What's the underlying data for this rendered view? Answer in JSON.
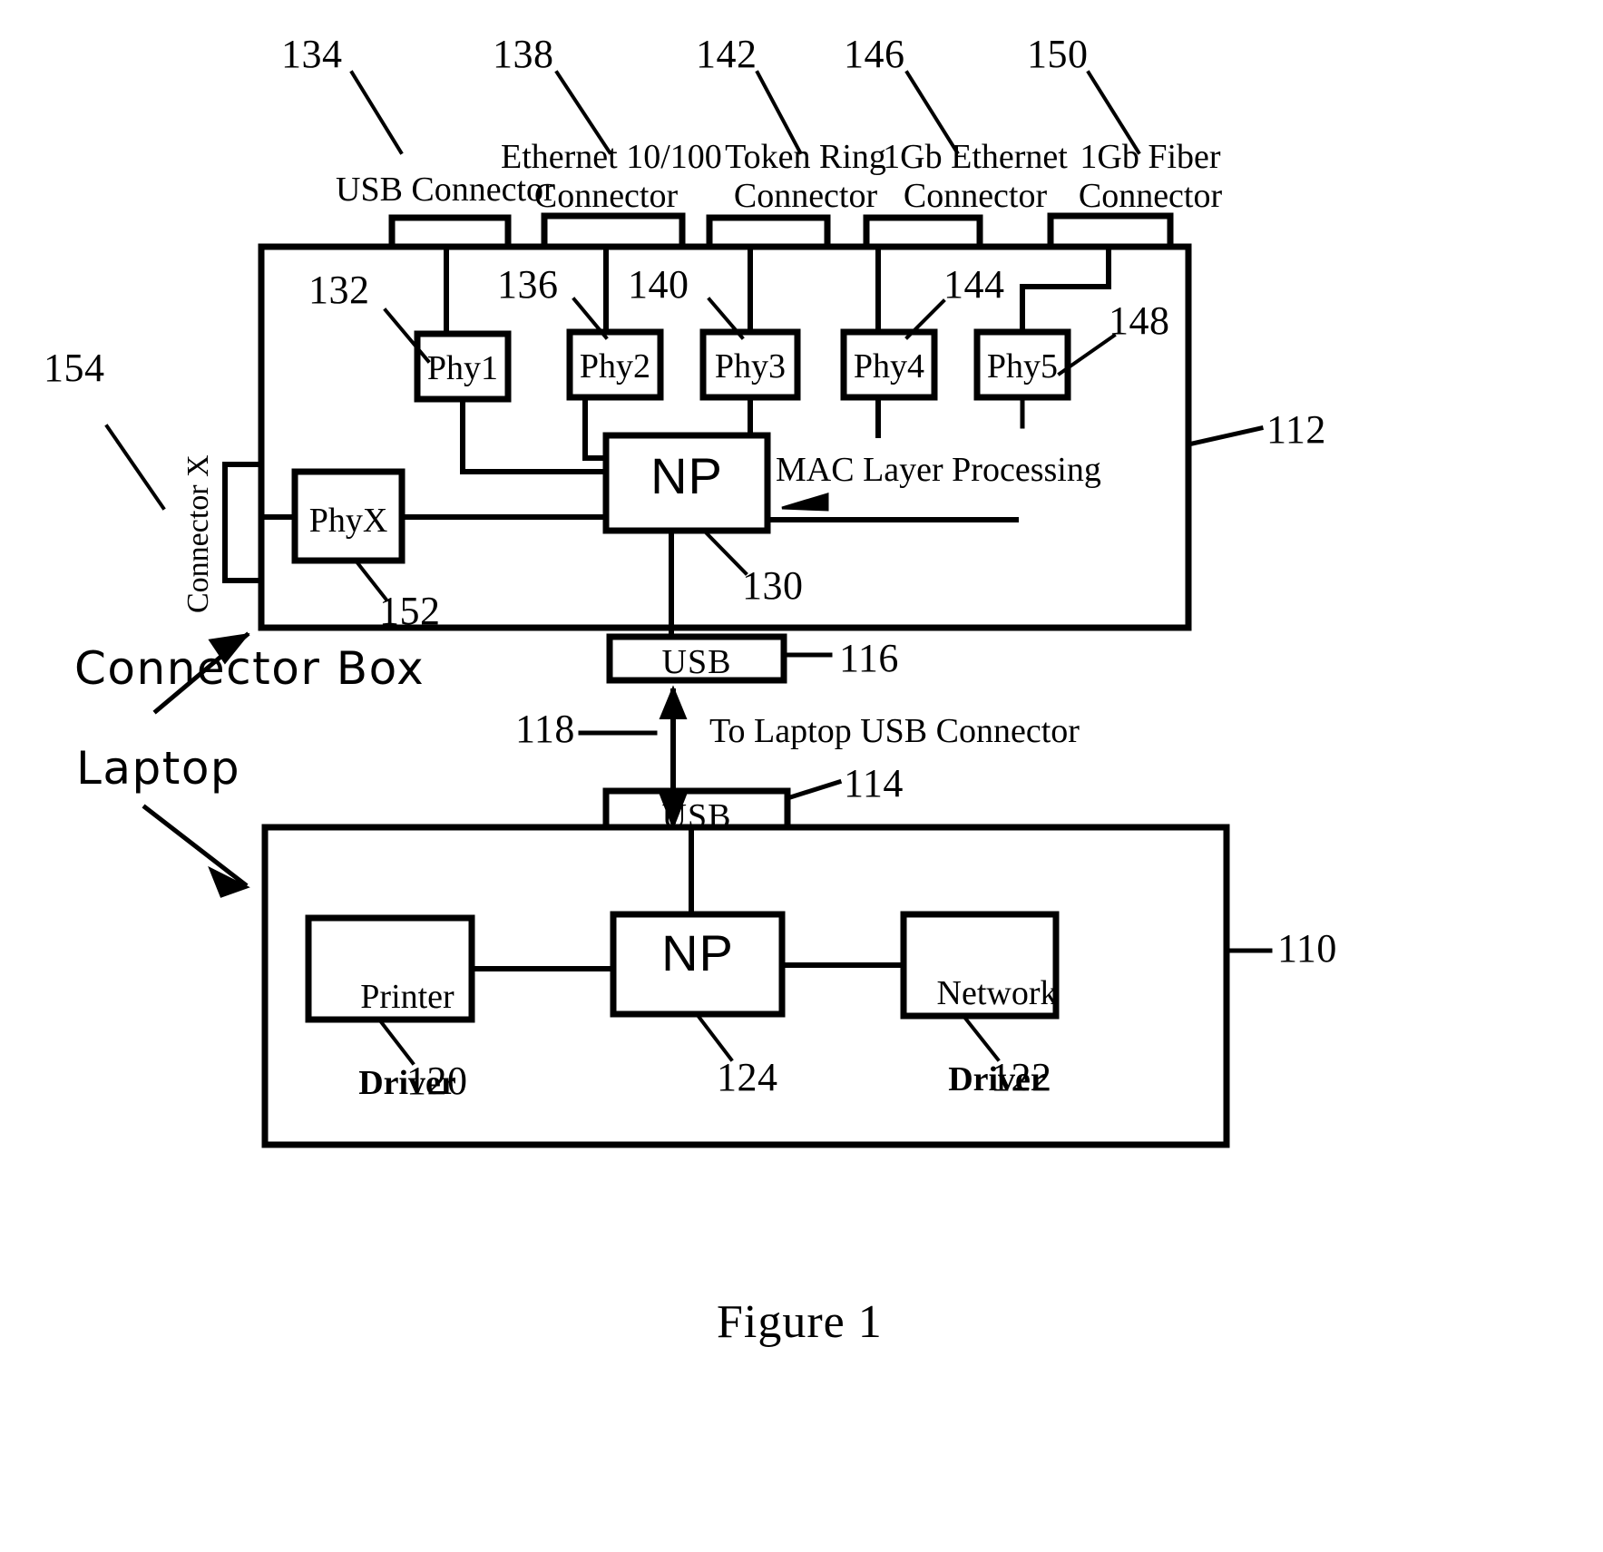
{
  "figure": {
    "caption": "Figure 1"
  },
  "top_connectors": [
    {
      "ref": "134",
      "label": "USB Connector"
    },
    {
      "ref": "138",
      "label": "Ethernet 10/100\nConnector"
    },
    {
      "ref": "142",
      "label": "Token Ring\nConnector"
    },
    {
      "ref": "146",
      "label": "1Gb Ethernet\nConnector"
    },
    {
      "ref": "150",
      "label": "1Gb Fiber\nConnector"
    }
  ],
  "phy_blocks": [
    {
      "ref": "132",
      "label": "Phy1"
    },
    {
      "ref": "136",
      "label": "Phy2"
    },
    {
      "ref": "140",
      "label": "Phy3"
    },
    {
      "ref": "144",
      "label": "Phy4"
    },
    {
      "ref": "148",
      "label": "Phy5"
    }
  ],
  "connector_box": {
    "ref": "112",
    "callout": "Connector Box",
    "np": {
      "label": "NP",
      "ref": "130"
    },
    "mac_note": "MAC Layer Processing",
    "phyx": {
      "label": "PhyX",
      "ref": "152"
    },
    "connector_x": {
      "label": "Connector X",
      "ref": "154"
    },
    "usb_port": {
      "label": "USB",
      "ref": "116"
    }
  },
  "link": {
    "ref": "118",
    "note": "To Laptop USB Connector"
  },
  "laptop": {
    "ref": "110",
    "callout": "Laptop",
    "usb_port": {
      "label": "USB",
      "ref": "114"
    },
    "printer_driver": {
      "line1": "Printer",
      "line2": "Driver",
      "ref": "120"
    },
    "np": {
      "label": "NP",
      "ref": "124"
    },
    "network_driver": {
      "line1": "Network",
      "line2": "Driver",
      "ref": "122"
    }
  },
  "colors": {
    "ink": "#000000",
    "paper": "#ffffff"
  }
}
